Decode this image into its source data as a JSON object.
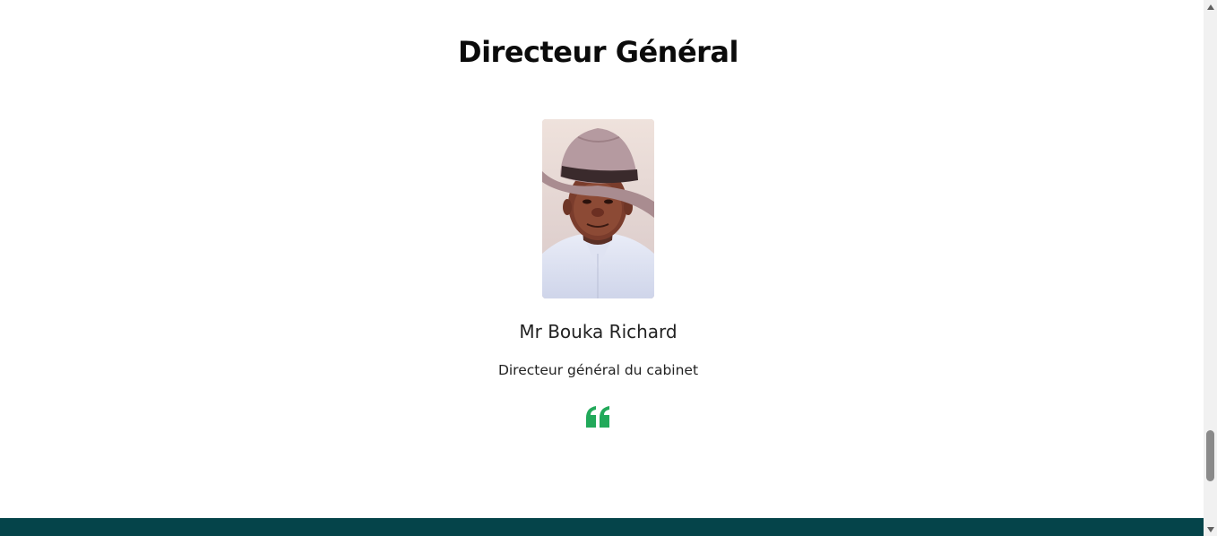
{
  "section": {
    "title": "Directeur Général"
  },
  "director": {
    "name": "Mr Bouka Richard",
    "role": "Directeur général du cabinet",
    "photo_icon": "portrait-photo"
  },
  "quote": {
    "icon": "quote-left-icon",
    "color": "#22a95a"
  },
  "colors": {
    "footer": "#05444a",
    "title": "#0b0b0b",
    "text": "#222222"
  }
}
